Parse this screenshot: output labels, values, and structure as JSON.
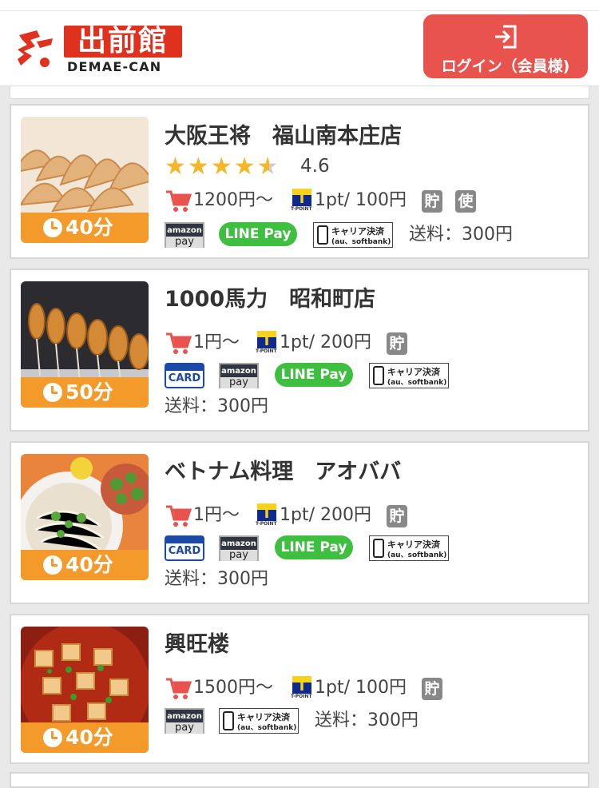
{
  "header": {
    "logo_text": "出前館",
    "logo_sub": "DEMAE-CAN",
    "login_label": "ログイン（会員様)"
  },
  "colors": {
    "brand": "#e0301e",
    "login_bg": "#e8534d",
    "time_bg": "#f39a2a",
    "star": "#f6b629"
  },
  "shops": [
    {
      "name": "大阪王将　福山南本庄店",
      "rating": "4.6",
      "stars": 4.6,
      "time": "40分",
      "min_order": "1200円〜",
      "points": "1pt/ 100円",
      "badges": [
        "貯",
        "使"
      ],
      "payments": [
        "amazon pay",
        "LINE Pay",
        "キャリア決済"
      ],
      "delivery_fee": "送料：300円",
      "image": "gyoza"
    },
    {
      "name": "1000馬力　昭和町店",
      "time": "50分",
      "min_order": "1円〜",
      "points": "1pt/ 200円",
      "badges": [
        "貯"
      ],
      "payments": [
        "CARD",
        "amazon pay",
        "LINE Pay",
        "キャリア決済"
      ],
      "delivery_fee": "送料：300円",
      "image": "kushikatsu"
    },
    {
      "name": "ベトナム料理　アオババ",
      "time": "40分",
      "min_order": "1円〜",
      "points": "1pt/ 200円",
      "badges": [
        "貯"
      ],
      "payments": [
        "CARD",
        "amazon pay",
        "LINE Pay",
        "キャリア決済"
      ],
      "delivery_fee": "送料：300円",
      "image": "pho"
    },
    {
      "name": "興旺楼",
      "time": "40分",
      "min_order": "1500円〜",
      "points": "1pt/ 100円",
      "badges": [
        "貯"
      ],
      "payments": [
        "amazon pay",
        "キャリア決済"
      ],
      "delivery_fee": "送料：300円",
      "image": "mapo-tofu"
    }
  ],
  "labels": {
    "amazon": "amazon",
    "pay": "pay",
    "linepay": "LINE Pay",
    "card": "CARD",
    "carrier_1": "キャリア決済",
    "carrier_2": "(au、softbank)",
    "tpoint": "T-POINT",
    "t": "T"
  }
}
